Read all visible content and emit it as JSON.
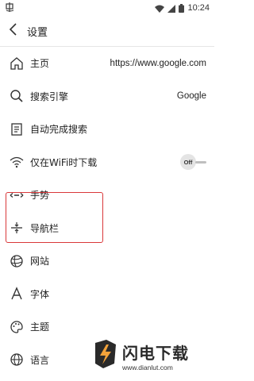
{
  "statusbar": {
    "time": "10:24",
    "app_icon": "app-notification-icon"
  },
  "appbar": {
    "title": "设置"
  },
  "items": [
    {
      "label": "主页",
      "value": "https://www.google.com",
      "icon": "home-icon"
    },
    {
      "label": "搜索引擎",
      "value": "Google",
      "icon": "search-icon"
    },
    {
      "label": "自动完成搜索",
      "icon": "document-icon"
    },
    {
      "label": "仅在WiFi时下载",
      "toggle": "Off",
      "icon": "wifi-icon"
    },
    {
      "label": "手势",
      "icon": "gesture-icon"
    },
    {
      "label": "导航栏",
      "icon": "navbar-icon",
      "highlighted": true
    },
    {
      "label": "网站",
      "icon": "globe-icon"
    },
    {
      "label": "字体",
      "icon": "font-icon"
    },
    {
      "label": "主题",
      "icon": "palette-icon"
    },
    {
      "label": "语言",
      "icon": "language-icon"
    }
  ],
  "watermark": {
    "title": "闪电下载",
    "url": "www.dianlut.com"
  },
  "colors": {
    "highlight": "#d9383a",
    "watermark_orange": "#f2a23a",
    "watermark_dark": "#2a2a2a"
  }
}
